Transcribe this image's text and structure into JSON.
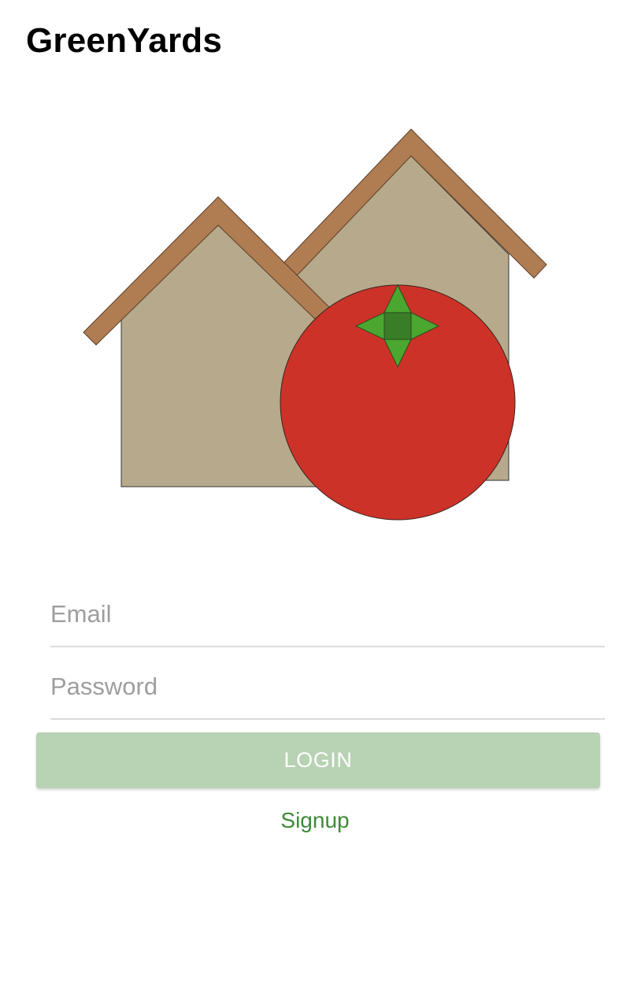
{
  "app": {
    "title": "GreenYards"
  },
  "logo": {
    "icon": "houses-with-tomato-logo",
    "colors": {
      "house_wall": "#b7a98b",
      "roof": "#b07c52",
      "tomato": "#cd3228",
      "leaf": "#4ba72f",
      "leaf_center": "#397e27"
    }
  },
  "form": {
    "email": {
      "placeholder": "Email",
      "value": ""
    },
    "password": {
      "placeholder": "Password",
      "value": ""
    },
    "login_label": "LOGIN",
    "signup_label": "Signup"
  },
  "theme": {
    "accent": "#3e8a37",
    "login_button_bg": "#b8d2b4"
  }
}
